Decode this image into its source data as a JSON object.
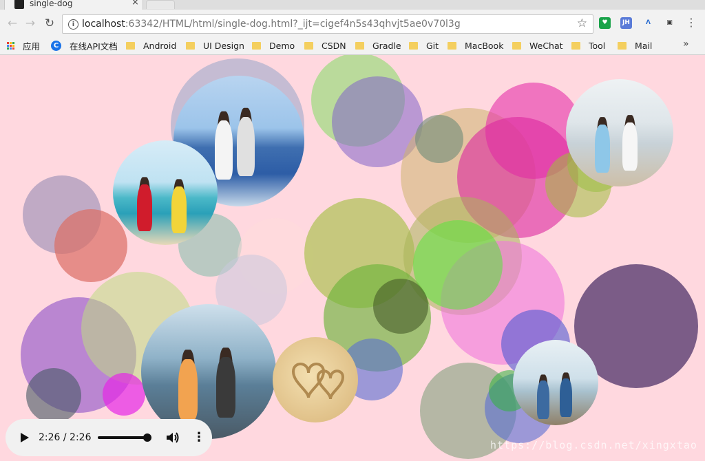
{
  "tab": {
    "title": "single-dog",
    "close": "×"
  },
  "nav": {
    "back": "←",
    "forward": "→",
    "reload": "↻"
  },
  "address": {
    "host": "localhost",
    "rest": ":63342/HTML/html/single-dog.html?_ijt=cigef4n5s43qhvjt5ae0v70l3g",
    "info": "i"
  },
  "extensions": [
    {
      "name": "shield-ext-icon",
      "label": "♥",
      "color": "#1aa34a"
    },
    {
      "name": "jh-ext-icon",
      "label": "JH",
      "color": "#5a7bd8"
    },
    {
      "name": "a-ext-icon",
      "label": "Λ",
      "color": "#2d6fd1"
    },
    {
      "name": "tab-ext-icon",
      "label": "▣",
      "color": "#333333"
    }
  ],
  "bookmarks": {
    "apps": "应用",
    "api": "在线API文档",
    "items": [
      "Android",
      "UI Design",
      "Demo",
      "CSDN",
      "Gradle",
      "Git",
      "MacBook",
      "WeChat",
      "Tool",
      "Mail"
    ],
    "more": "»"
  },
  "player": {
    "time": "2:26 / 2:26",
    "progress": 1.0
  },
  "watermark": "https://blog.csdn.net/xingxtao"
}
